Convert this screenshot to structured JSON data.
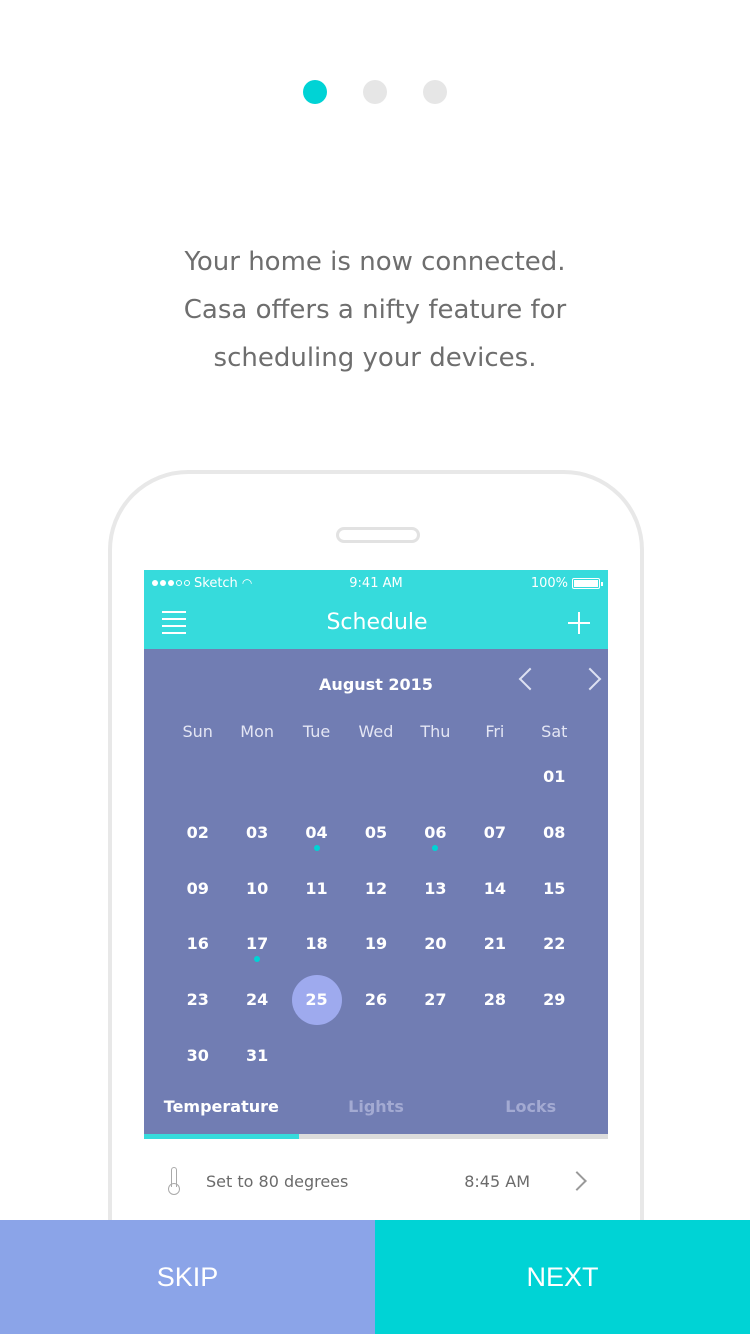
{
  "pager": {
    "count": 3,
    "active_index": 0
  },
  "intro": {
    "lines": [
      "Your home is now connected.",
      "Casa offers a nifty feature for",
      "scheduling your devices."
    ]
  },
  "statusbar": {
    "carrier": "Sketch",
    "time": "9:41 AM",
    "battery": "100%",
    "battery_level": 1.0
  },
  "appbar": {
    "title": "Schedule"
  },
  "calendar": {
    "month": "August 2015",
    "weekdays": [
      "Sun",
      "Mon",
      "Tue",
      "Wed",
      "Thu",
      "Fri",
      "Sat"
    ],
    "weeks": [
      [
        "",
        "",
        "",
        "",
        "",
        "",
        "01"
      ],
      [
        "02",
        "03",
        "04",
        "05",
        "06",
        "07",
        "08"
      ],
      [
        "09",
        "10",
        "11",
        "12",
        "13",
        "14",
        "15"
      ],
      [
        "16",
        "17",
        "18",
        "19",
        "20",
        "21",
        "22"
      ],
      [
        "23",
        "24",
        "25",
        "26",
        "27",
        "28",
        "29"
      ],
      [
        "30",
        "31",
        "",
        "",
        "",
        "",
        ""
      ]
    ],
    "selected": "25",
    "event_days": [
      "04",
      "06",
      "17"
    ]
  },
  "tabs": [
    {
      "label": "Temperature",
      "active": true
    },
    {
      "label": "Lights",
      "active": false
    },
    {
      "label": "Locks",
      "active": false
    }
  ],
  "schedule_item": {
    "text": "Set to 80 degrees",
    "time": "8:45 AM"
  },
  "buttons": {
    "skip": "SKIP",
    "next": "NEXT"
  },
  "colors": {
    "accent": "#00d3d5",
    "calendar_bg": "#717db3",
    "skip_bg": "#8ba4e8",
    "header_bg": "#36dbdc"
  }
}
